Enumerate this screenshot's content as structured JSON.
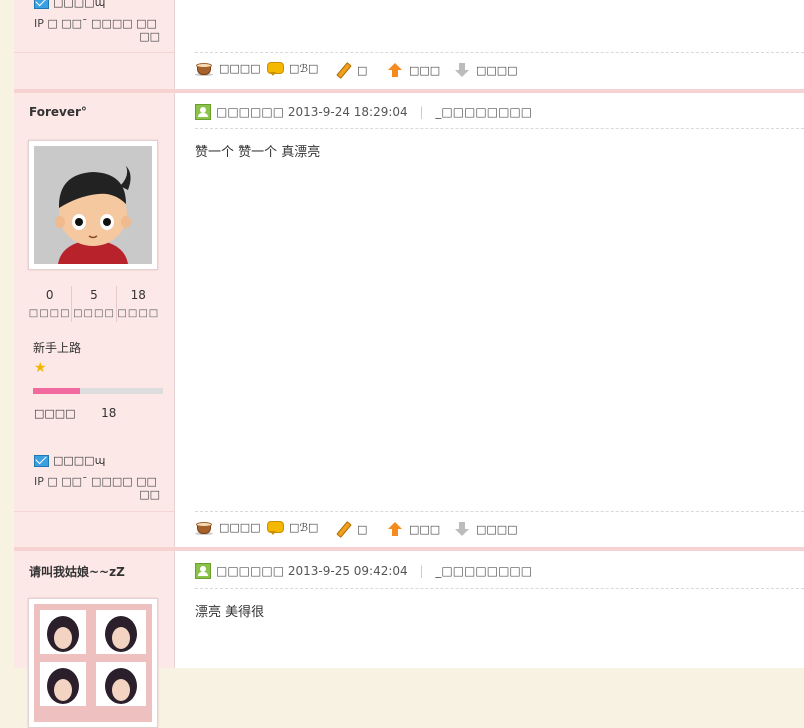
{
  "actions": {
    "a1": "□□□□",
    "a2": "□ℬ□",
    "a3": "□",
    "a4": "□□□",
    "a5": "□□□□"
  },
  "top_block": {
    "mail_label": "□□□□ɰ",
    "ip_line1": "IP □  □□ˉ □□□□ □□",
    "ip_line2": "□□"
  },
  "posts": [
    {
      "username": "Forever°",
      "stats": [
        {
          "value": "0",
          "label": "□□□□"
        },
        {
          "value": "5",
          "label": "□□□□"
        },
        {
          "value": "18",
          "label": "□□□□"
        }
      ],
      "rank": "新手上路",
      "progress_fraction": 0.36,
      "points_label": "□□□□",
      "points_value": "18",
      "mail_label": "□□□□ɰ",
      "ip_line1": "IP □  □□ˉ □□□□ □□",
      "ip_line2": "□□",
      "meta_prefix": "□□□□□□",
      "timestamp": "2013-9-24 18:29:04",
      "meta_suffix": "_□□□□□□□□",
      "message": "赞一个 赞一个 真漂亮"
    },
    {
      "username": "请叫我姑娘~~zZ",
      "meta_prefix": "□□□□□□",
      "timestamp": "2013-9-25 09:42:04",
      "meta_suffix": "_□□□□□□□□",
      "message": "漂亮 美得很"
    }
  ],
  "colors": {
    "page_bg": "#f7f2e2",
    "sidebar_bg": "#fde8e8",
    "progress_fill": "#f06aa0"
  }
}
